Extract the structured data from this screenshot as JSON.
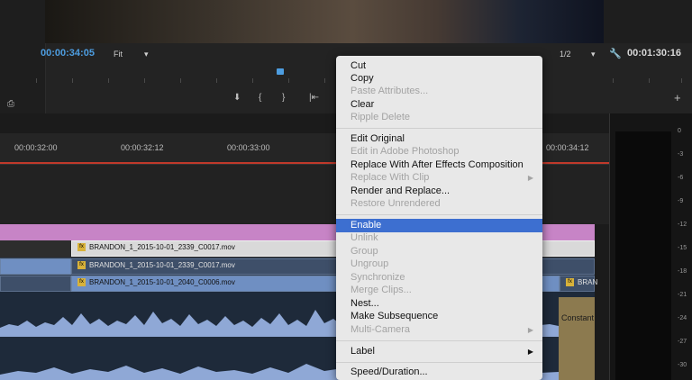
{
  "monitor": {
    "current_time": "00:00:34:05",
    "zoom": "Fit",
    "resolution": "1/2",
    "duration": "00:01:30:16"
  },
  "timeline": {
    "ruler": [
      "00:00:32:00",
      "00:00:32:12",
      "00:00:33:00",
      "00:00:34:12"
    ],
    "clips": {
      "v3": "BRANDON_1_2015-10-01_2339_C0017.mov",
      "v2": "BRANDON_1_2015-10-01_2339_C0017.mov",
      "v1": "BRANDON_1_2015-10-01_2040_C0006.mov",
      "v1_next": "BRAN",
      "fx_label": "fx",
      "audio_transition": "Constant"
    }
  },
  "meter": {
    "scale": [
      "0",
      "-3",
      "-6",
      "-9",
      "-12",
      "-15",
      "-18",
      "-21",
      "-24",
      "-27",
      "-30"
    ]
  },
  "context_menu": {
    "items": [
      {
        "label": "Cut",
        "enabled": true
      },
      {
        "label": "Copy",
        "enabled": true
      },
      {
        "label": "Paste Attributes...",
        "enabled": false
      },
      {
        "label": "Clear",
        "enabled": true
      },
      {
        "label": "Ripple Delete",
        "enabled": false
      },
      {
        "label": "Edit Original",
        "enabled": true
      },
      {
        "label": "Edit in Adobe Photoshop",
        "enabled": false
      },
      {
        "label": "Replace With After Effects Composition",
        "enabled": true
      },
      {
        "label": "Replace With Clip",
        "enabled": false
      },
      {
        "label": "Render and Replace...",
        "enabled": true
      },
      {
        "label": "Restore Unrendered",
        "enabled": false
      },
      {
        "label": "Enable",
        "enabled": true,
        "highlighted": true
      },
      {
        "label": "Unlink",
        "enabled": false
      },
      {
        "label": "Group",
        "enabled": false
      },
      {
        "label": "Ungroup",
        "enabled": false
      },
      {
        "label": "Synchronize",
        "enabled": false
      },
      {
        "label": "Merge Clips...",
        "enabled": false
      },
      {
        "label": "Nest...",
        "enabled": true
      },
      {
        "label": "Make Subsequence",
        "enabled": true
      },
      {
        "label": "Multi-Camera",
        "enabled": false
      },
      {
        "label": "Label",
        "enabled": true
      },
      {
        "label": "Speed/Duration...",
        "enabled": true
      }
    ]
  },
  "colors": {
    "timecode": "#4d9de0",
    "menu_highlight": "#3d6fd0",
    "playhead": "#c0392b",
    "clip_blue": "#6f8fc2",
    "adjustment_pink": "#c784c6"
  }
}
